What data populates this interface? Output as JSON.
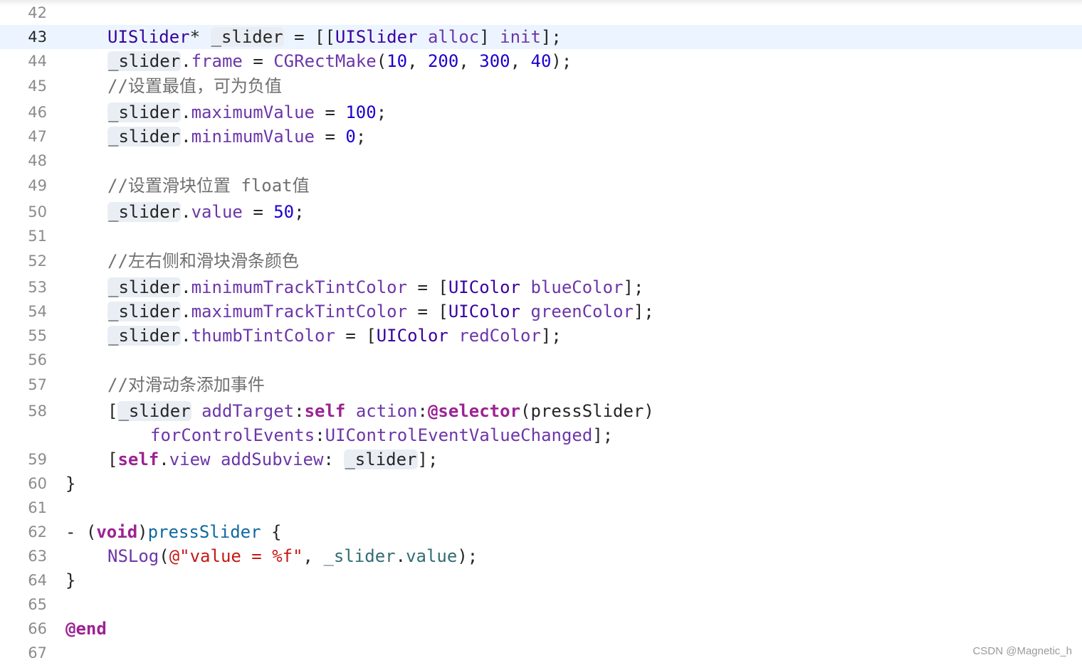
{
  "editor": {
    "lines": [
      {
        "num": "42"
      },
      {
        "num": "43"
      },
      {
        "num": "44"
      },
      {
        "num": "45"
      },
      {
        "num": "46"
      },
      {
        "num": "47"
      },
      {
        "num": "48"
      },
      {
        "num": "49"
      },
      {
        "num": "50"
      },
      {
        "num": "51"
      },
      {
        "num": "52"
      },
      {
        "num": "53"
      },
      {
        "num": "54"
      },
      {
        "num": "55"
      },
      {
        "num": "56"
      },
      {
        "num": "57"
      },
      {
        "num": "58"
      },
      {
        "num": "59"
      },
      {
        "num": "60"
      },
      {
        "num": "61"
      },
      {
        "num": "62"
      },
      {
        "num": "63"
      },
      {
        "num": "64"
      },
      {
        "num": "65"
      },
      {
        "num": "66"
      },
      {
        "num": "67"
      }
    ],
    "current_line": "43",
    "tokens": {
      "uislider_class": "UISlider",
      "star": "*",
      "slider_var": "_slider",
      "assign": "=",
      "open2": "[[",
      "alloc": "alloc",
      "init": "init",
      "close_semi": "];",
      "dot": ".",
      "frame": "frame",
      "cgrectmake": "CGRectMake",
      "paren_open": "(",
      "n10": "10",
      "n200": "200",
      "n300": "300",
      "n40": "40",
      "comma": ",",
      "paren_close_semi": ");",
      "comment_max_min": "//设置最值，可为负值",
      "maximumValue": "maximumValue",
      "n100": "100",
      "semi": ";",
      "minimumValue": "minimumValue",
      "n0": "0",
      "comment_pos": "//设置滑块位置 float值",
      "value": "value",
      "n50": "50",
      "comment_colors": "//左右侧和滑块滑条颜色",
      "minTrack": "minimumTrackTintColor",
      "maxTrack": "maximumTrackTintColor",
      "thumbTint": "thumbTintColor",
      "bracket_open": "[",
      "uicolor": "UIColor",
      "blueColor": "blueColor",
      "greenColor": "greenColor",
      "redColor": "redColor",
      "comment_event": "//对滑动条添加事件",
      "addTarget": "addTarget",
      "colon": ":",
      "self": "self",
      "action": "action",
      "selector": "@selector",
      "pressSlider_arg": "(pressSlider)",
      "forControlEvents": "forControlEvents",
      "valueChanged": "UIControlEventValueChanged",
      "view": "view",
      "addSubview": "addSubview",
      "brace_close": "}",
      "dash_paren": "- (",
      "void": "void",
      "paren_close": ")",
      "pressSlider": "pressSlider",
      "brace_open": " {",
      "nslog": "NSLog",
      "fmt_string": "@\"value = %f\"",
      "end": "@end"
    }
  },
  "watermark": "CSDN @Magnetic_h"
}
